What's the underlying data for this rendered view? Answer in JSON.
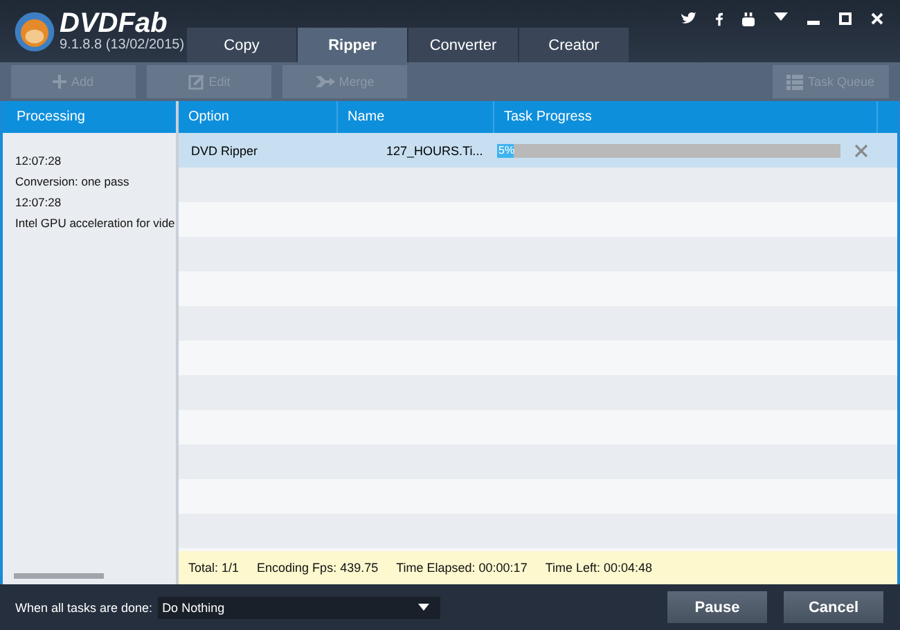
{
  "app": {
    "name": "DVDFab",
    "version": "9.1.8.8 (13/02/2015)"
  },
  "tabs": [
    {
      "label": "Copy",
      "selected": false
    },
    {
      "label": "Ripper",
      "selected": true
    },
    {
      "label": "Converter",
      "selected": false
    },
    {
      "label": "Creator",
      "selected": false
    }
  ],
  "toolbar": [
    {
      "label": "Add",
      "kind": "add",
      "disabled": true
    },
    {
      "label": "Edit",
      "kind": "edit",
      "disabled": true
    },
    {
      "label": "Merge",
      "kind": "merge",
      "disabled": true
    }
  ],
  "task_queue": {
    "label": "Task Queue",
    "disabled": true
  },
  "log": {
    "title": "Processing",
    "lines": [
      "12:07:28",
      "Conversion: one pass",
      "12:07:28",
      "Intel GPU acceleration for vide"
    ]
  },
  "table": {
    "columns": [
      "Option",
      "Name",
      "Task Progress"
    ],
    "rows": [
      {
        "option": "DVD Ripper",
        "name": "127_HOURS.Ti...",
        "progress_label": "5%",
        "level": 0.05,
        "selected": true
      }
    ]
  },
  "status": [
    "Total: 1/1",
    "Encoding Fps: 439.75",
    "Time Elapsed: 00:00:17",
    "Time Left: 00:04:48"
  ],
  "footer": {
    "label": "When all tasks are done:",
    "value": "Do Nothing",
    "buttons": [
      "Pause",
      "Cancel"
    ]
  }
}
